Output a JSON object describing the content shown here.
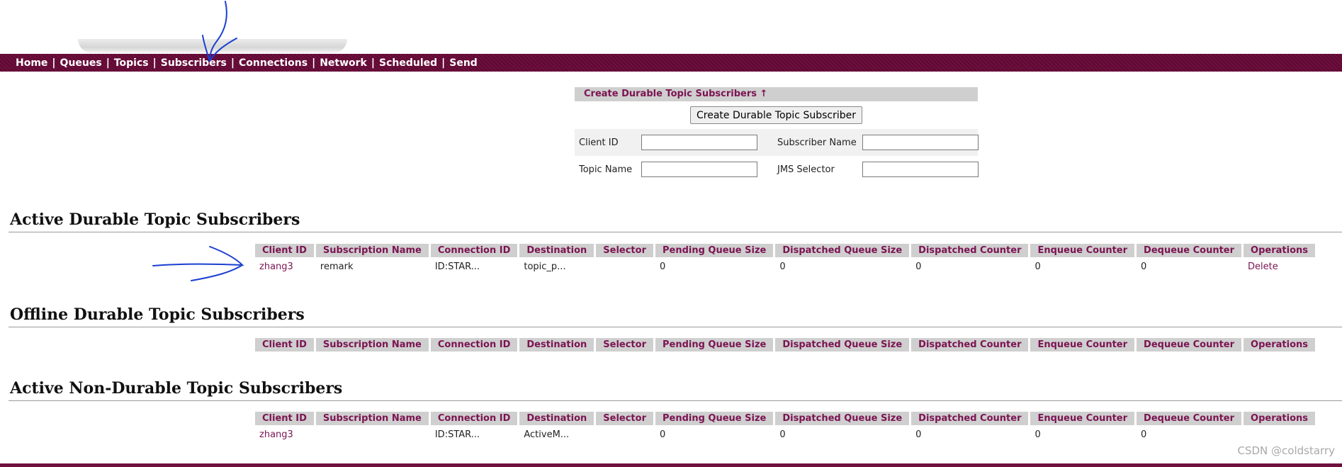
{
  "nav": {
    "items": [
      "Home",
      "Queues",
      "Topics",
      "Subscribers",
      "Connections",
      "Network",
      "Scheduled",
      "Send"
    ],
    "separator": "|"
  },
  "create": {
    "header": "Create Durable Topic Subscribers ↑",
    "button": "Create Durable Topic Subscriber",
    "client_id_label": "Client ID",
    "subscriber_name_label": "Subscriber Name",
    "topic_name_label": "Topic Name",
    "jms_selector_label": "JMS Selector"
  },
  "columns": [
    "Client ID",
    "Subscription Name",
    "Connection ID",
    "Destination",
    "Selector",
    "Pending Queue Size",
    "Dispatched Queue Size",
    "Dispatched Counter",
    "Enqueue Counter",
    "Dequeue Counter",
    "Operations"
  ],
  "sections": {
    "active_durable": {
      "title": "Active Durable Topic Subscribers",
      "rows": [
        [
          "zhang3",
          "remark",
          "ID:STAR...",
          "topic_p...",
          "",
          "0",
          "0",
          "0",
          "0",
          "0",
          "Delete"
        ]
      ]
    },
    "offline_durable": {
      "title": "Offline Durable Topic Subscribers",
      "rows": []
    },
    "active_non_durable": {
      "title": "Active Non-Durable Topic Subscribers",
      "rows": [
        [
          "zhang3",
          "",
          "ID:STAR...",
          "ActiveM...",
          "",
          "0",
          "0",
          "0",
          "0",
          "0",
          ""
        ]
      ]
    }
  },
  "watermark": "CSDN @coldstarry",
  "colors": {
    "brand": "#6e0f3e",
    "link": "#7b1452",
    "header_bg": "#cfcfcf",
    "annotation": "#1a3fd1"
  }
}
